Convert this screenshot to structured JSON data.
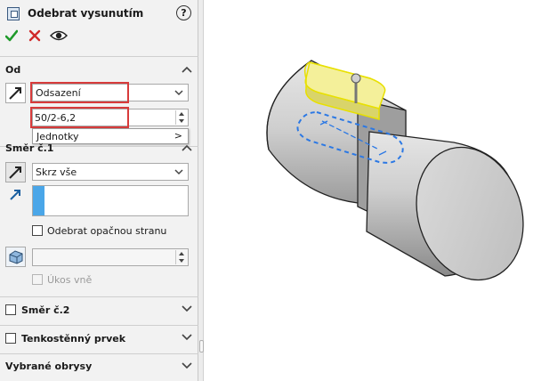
{
  "panel": {
    "title": "Odebrat vysunutím",
    "help_icon": "?",
    "actions": {
      "ok_icon": "check-icon",
      "cancel_icon": "x-icon",
      "preview_icon": "eye-icon"
    }
  },
  "od": {
    "title": "Od",
    "type_value": "Odsazení",
    "offset_value": "50/2-6,2",
    "popup_item": "Jednotky",
    "popup_arrow": ">"
  },
  "dir1": {
    "title": "Směr č.1",
    "end_condition": "Skrz vše",
    "flip_opposite_label": "Odebrat opačnou stranu",
    "flip_opposite_checked": false,
    "draft_outward_label": "Úkos vně",
    "draft_outward_checked": false,
    "draft_angle_value": ""
  },
  "dir2": {
    "title": "Směr č.2",
    "checked": false
  },
  "thin": {
    "title": "Tenkostěnný prvek",
    "checked": false
  },
  "contours": {
    "title": "Vybrané obrysy"
  },
  "colors": {
    "highlight_red": "#d83b3b",
    "selection_blue": "#4aa6e8",
    "preview_yellow": "#e8e000",
    "sketch_blue": "#2b78e4"
  }
}
